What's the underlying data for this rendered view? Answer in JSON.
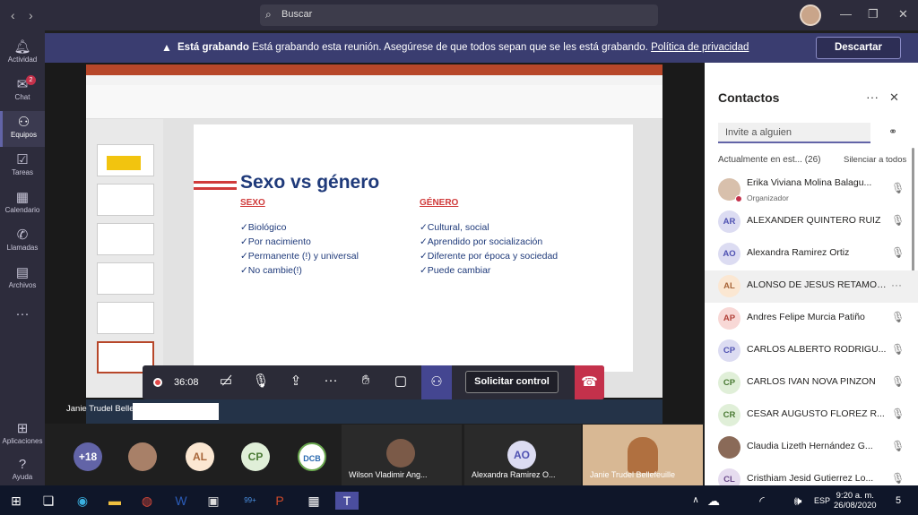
{
  "search": {
    "placeholder": "Buscar"
  },
  "rail": [
    {
      "label": "Actividad",
      "icon": "bell-icon"
    },
    {
      "label": "Chat",
      "icon": "chat-icon",
      "badge": "2"
    },
    {
      "label": "Equipos",
      "icon": "teams-icon"
    },
    {
      "label": "Tareas",
      "icon": "tasks-icon"
    },
    {
      "label": "Calendario",
      "icon": "calendar-icon"
    },
    {
      "label": "Llamadas",
      "icon": "phone-icon"
    },
    {
      "label": "Archivos",
      "icon": "files-icon"
    },
    {
      "label": "Aplicaciones",
      "icon": "apps-icon"
    },
    {
      "label": "Ayuda",
      "icon": "help-icon"
    }
  ],
  "banner": {
    "bold": "Está grabando",
    "text": "Está grabando esta reunión. Asegúrese de que todos sepan que se les está grabando.",
    "link": "Política de privacidad",
    "dismiss": "Descartar"
  },
  "slide": {
    "title": "Sexo vs género",
    "left_head": "SEXO",
    "right_head": "GÉNERO",
    "left_items": [
      "✓Biológico",
      "✓Por nacimiento",
      "✓Permanente (!) y  universal",
      "✓No cambie(!)"
    ],
    "right_items": [
      "✓Cultural, social",
      "✓Aprendido por socialización",
      "✓Diferente por época y sociedad",
      "✓Puede cambiar"
    ]
  },
  "controls": {
    "timer": "36:08",
    "request_control": "Solicitar control"
  },
  "sharer": "Janie Trudel Bellefeuille",
  "contacts": {
    "title": "Contactos",
    "invite_placeholder": "Invite a alguien",
    "section": "Actualmente en est...  (26)",
    "mute_all": "Silenciar a todos",
    "people": [
      {
        "initials": "",
        "name": "Erika Viviana Molina Balagu...",
        "role": "Organizador",
        "photo": true
      },
      {
        "initials": "AR",
        "name": "ALEXANDER QUINTERO RUIZ"
      },
      {
        "initials": "AO",
        "name": "Alexandra Ramirez Ortiz"
      },
      {
        "initials": "AL",
        "name": "ALONSO DE JESUS RETAMOSO...",
        "highlight": true
      },
      {
        "initials": "AP",
        "name": "Andres Felipe Murcia Patiño"
      },
      {
        "initials": "CP",
        "name": "CARLOS ALBERTO RODRIGU..."
      },
      {
        "initials": "CP",
        "name": "CARLOS IVAN NOVA PINZON"
      },
      {
        "initials": "CR",
        "name": "CESAR AUGUSTO FLOREZ R..."
      },
      {
        "initials": "",
        "name": "Claudia Lizeth Hernández G...",
        "photo": true
      },
      {
        "initials": "CL",
        "name": "Cristhiam Jesid Gutierrez Lo..."
      }
    ]
  },
  "strip": {
    "more": "+18",
    "al": "AL",
    "cp": "CP",
    "tile1": "Wilson Vladimir Ang...",
    "tile2_initials": "AO",
    "tile2": "Alexandra Ramirez O...",
    "tile3": "Janie Trudel Bellefeuille"
  },
  "taskbar": {
    "time": "9:20 a. m.",
    "date": "26/08/2020",
    "lang": "ESP",
    "mail_badge": "99+",
    "notif": "5"
  }
}
